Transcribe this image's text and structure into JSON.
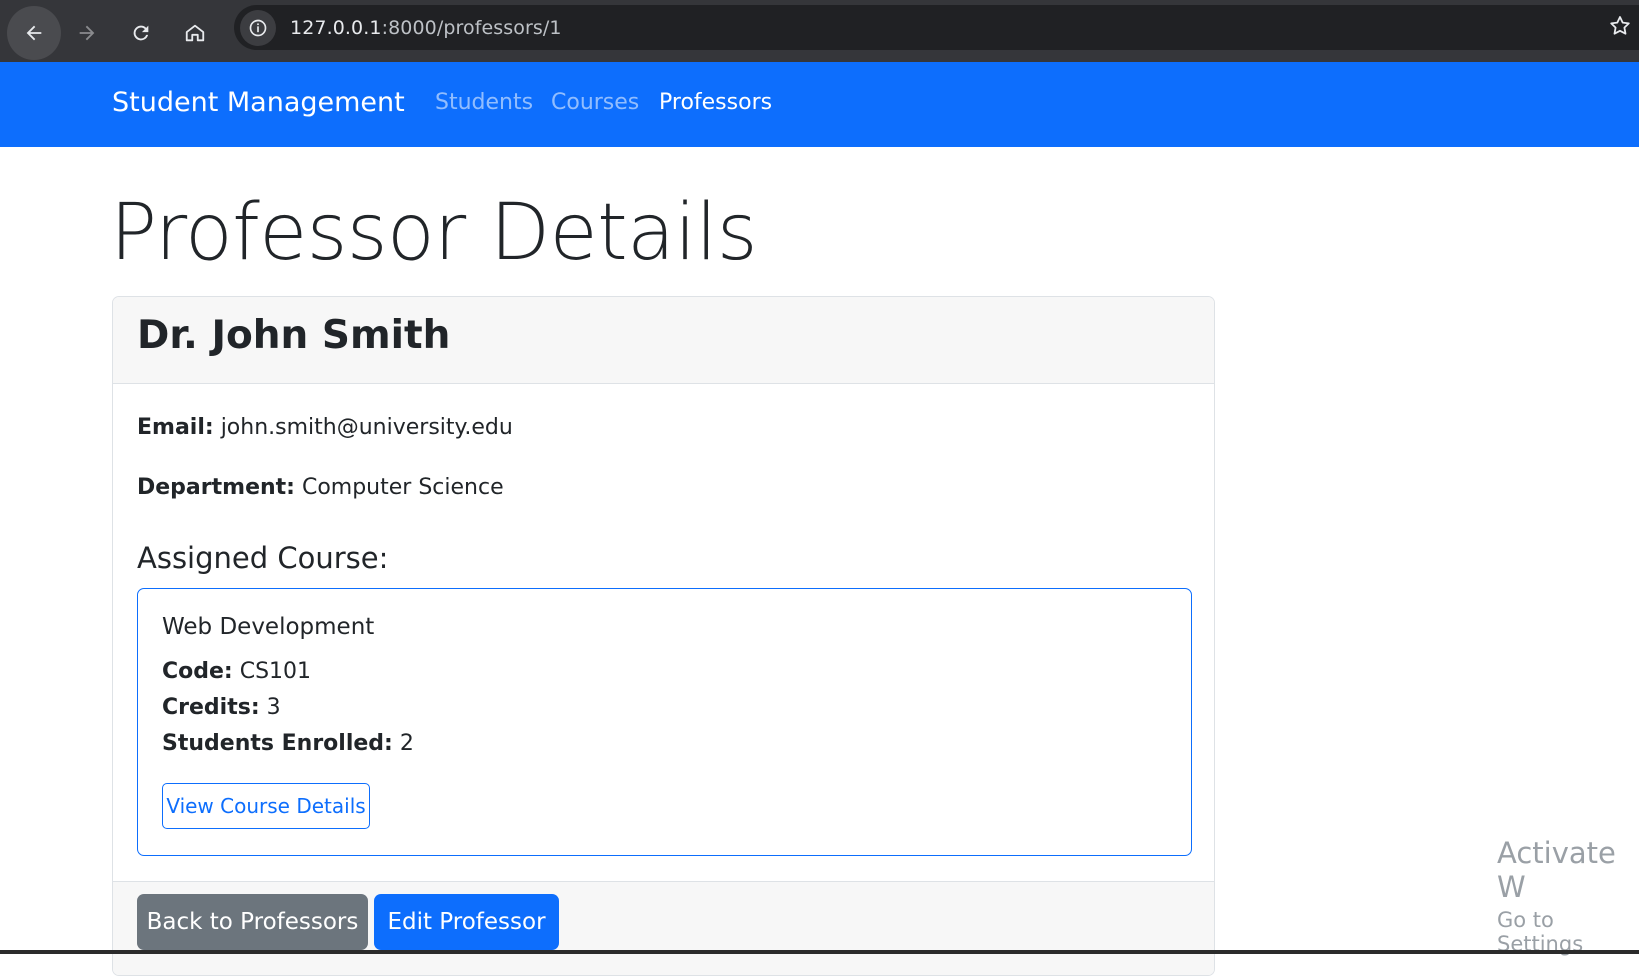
{
  "browser": {
    "url_host": "127.0.0.1",
    "url_rest": ":8000/professors/1"
  },
  "navbar": {
    "brand": "Student Management",
    "links": [
      {
        "label": "Students",
        "active": false
      },
      {
        "label": "Courses",
        "active": false
      },
      {
        "label": "Professors",
        "active": true
      }
    ]
  },
  "page": {
    "title": "Professor Details"
  },
  "professor": {
    "name": "Dr. John Smith",
    "email_label": "Email:",
    "email": "john.smith@university.edu",
    "department_label": "Department:",
    "department": "Computer Science"
  },
  "assigned_course": {
    "section_title": "Assigned Course:",
    "title": "Web Development",
    "code_label": "Code:",
    "code": "CS101",
    "credits_label": "Credits:",
    "credits": "3",
    "enrolled_label": "Students Enrolled:",
    "enrolled": "2",
    "view_button": "View Course Details"
  },
  "footer": {
    "back_button": "Back to Professors",
    "edit_button": "Edit Professor"
  },
  "watermark": {
    "line1": "Activate W",
    "line2": "Go to Settings"
  },
  "colors": {
    "primary": "#0d6efd",
    "secondary": "#6c757d"
  }
}
